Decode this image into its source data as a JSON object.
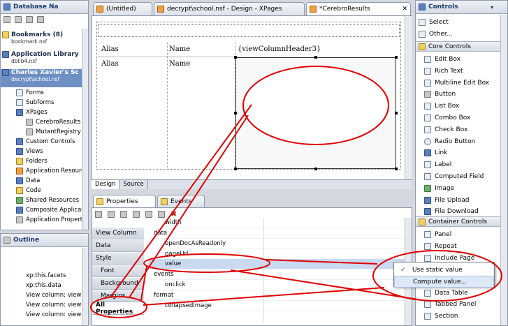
{
  "left_top": {
    "title": "Database Na",
    "items": [
      {
        "label": "Bookmarks (8)",
        "sub": "bookmark.nsf"
      },
      {
        "label": "Application Library",
        "sub": "dblib4.nsf"
      },
      {
        "label": "Charles Xavier's Sc",
        "sub": "decrypt\\school.nsf"
      }
    ],
    "tree": [
      "Forms",
      "Subforms",
      "XPages",
      "CerebroResults",
      "MutantRegistry",
      "Custom Controls",
      "Views",
      "Folders",
      "Application Resource",
      "Data",
      "Code",
      "Shared Resources",
      "Composite Applicati",
      "Application Properti"
    ]
  },
  "outline": {
    "title": "Outline",
    "items": [
      "xp:this.facets",
      "xp:this.data",
      "View column: view",
      "View column: view",
      "View column: view"
    ]
  },
  "editor_tabs": [
    "(Untitled)",
    "decrypt\\school.nsf - Design - XPages",
    "*CerebroResults"
  ],
  "editor": {
    "header_row": [
      "Alias",
      "Name",
      "{viewColumnHeader3}"
    ],
    "body_row": [
      "Alias",
      "Name"
    ],
    "bottom_tabs": [
      "Design",
      "Source"
    ]
  },
  "props": {
    "tabs": [
      "Properties",
      "Events"
    ],
    "side_tabs": [
      "View Column",
      "Data",
      "Style",
      "Font",
      "Background",
      "Margins",
      "All Properties"
    ],
    "rows": [
      "width",
      "data",
      "openDocAsReadonly",
      "pageUrl",
      "value",
      "events",
      "onclick",
      "format",
      "collapsedImage"
    ]
  },
  "context_menu": {
    "check": "✓",
    "items": [
      "Use static value",
      "Compute value..."
    ]
  },
  "controls": {
    "title": "Controls",
    "top_items": [
      "Select",
      "Other..."
    ],
    "core_title": "Core Controls",
    "core": [
      "Edit Box",
      "Rich Text",
      "Multiline Edit Box",
      "Button",
      "List Box",
      "Combo Box",
      "Check Box",
      "Radio Button",
      "Link",
      "Label",
      "Computed Field",
      "Image",
      "File Upload",
      "File Download"
    ],
    "container_title": "Container Controls",
    "container": [
      "Panel",
      "Repeat",
      "Include Page",
      "Data Table",
      "Tabbed Panel",
      "Section"
    ]
  },
  "colors": {
    "annotation": "#e00000",
    "selection": "#c9d9f0"
  }
}
